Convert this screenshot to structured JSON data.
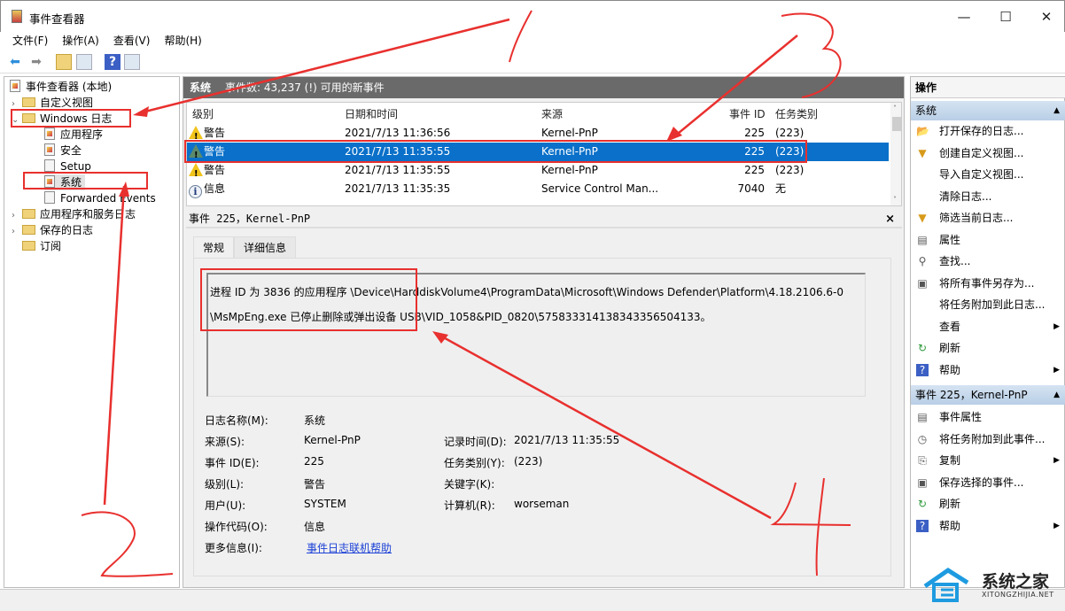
{
  "window": {
    "title": "事件查看器",
    "minimize": "—",
    "maximize": "☐",
    "close": "✕"
  },
  "menu": [
    "文件(F)",
    "操作(A)",
    "查看(V)",
    "帮助(H)"
  ],
  "toolbar": {
    "back": "back-icon",
    "forward": "forward-icon",
    "help": "?"
  },
  "tree": {
    "root": "事件查看器 (本地)",
    "items": [
      {
        "label": "自定义视图"
      },
      {
        "label": "Windows 日志",
        "children": [
          "应用程序",
          "安全",
          "Setup",
          "系统",
          "Forwarded Events"
        ]
      },
      {
        "label": "应用程序和服务日志"
      },
      {
        "label": "保存的日志"
      },
      {
        "label": "订阅"
      }
    ]
  },
  "main": {
    "header_title": "系统",
    "header_info": "事件数: 43,237 (!) 可用的新事件",
    "columns": [
      "级别",
      "日期和时间",
      "来源",
      "事件 ID",
      "任务类别"
    ],
    "rows": [
      {
        "level": "警告",
        "datetime": "2021/7/13 11:36:56",
        "source": "Kernel-PnP",
        "id": "225",
        "task": "(223)"
      },
      {
        "level": "警告",
        "datetime": "2021/7/13 11:35:55",
        "source": "Kernel-PnP",
        "id": "225",
        "task": "(223)",
        "selected": true
      },
      {
        "level": "警告",
        "datetime": "2021/7/13 11:35:55",
        "source": "Kernel-PnP",
        "id": "225",
        "task": "(223)"
      },
      {
        "level": "信息",
        "datetime": "2021/7/13 11:35:35",
        "source": "Service Control Man...",
        "id": "7040",
        "task": "无"
      }
    ]
  },
  "detail": {
    "title": "事件 225，Kernel-PnP",
    "close": "×",
    "tabs": [
      "常规",
      "详细信息"
    ],
    "message_line1": "进程 ID 为 3836 的应用程序 \\Device\\HarddiskVolume4\\ProgramData\\Microsoft\\Windows Defender\\Platform\\4.18.2106.6-0",
    "message_line2": "\\MsMpEng.exe 已停止删除或弹出设备 USB\\VID_1058&PID_0820\\575833314138343356504133。",
    "fields": {
      "log_name_label": "日志名称(M):",
      "log_name": "系统",
      "source_label": "来源(S):",
      "source": "Kernel-PnP",
      "logged_label": "记录时间(D):",
      "logged": "2021/7/13 11:35:55",
      "event_id_label": "事件 ID(E):",
      "event_id": "225",
      "task_label": "任务类别(Y):",
      "task": "(223)",
      "level_label": "级别(L):",
      "level": "警告",
      "keywords_label": "关键字(K):",
      "user_label": "用户(U):",
      "user": "SYSTEM",
      "computer_label": "计算机(R):",
      "computer": "worseman",
      "opcode_label": "操作代码(O):",
      "opcode": "信息",
      "more_label": "更多信息(I):",
      "more_link": "事件日志联机帮助"
    }
  },
  "actions": {
    "title": "操作",
    "section1": "系统",
    "items1": [
      "打开保存的日志...",
      "创建自定义视图...",
      "导入自定义视图...",
      "清除日志...",
      "筛选当前日志...",
      "属性",
      "查找...",
      "将所有事件另存为...",
      "将任务附加到此日志...",
      "查看",
      "刷新",
      "帮助"
    ],
    "section2": "事件 225，Kernel-PnP",
    "items2": [
      "事件属性",
      "将任务附加到此事件...",
      "复制",
      "保存选择的事件...",
      "刷新",
      "帮助"
    ]
  },
  "watermark": {
    "cn": "系统之家",
    "en": "XITONGZHIJIA.NET"
  },
  "annotations": [
    "1",
    "2",
    "3",
    "4"
  ],
  "colors": {
    "annotation": "#e8302e",
    "selection": "#0a70c9",
    "header": "#6a6a6a",
    "link": "#1a3fd6"
  }
}
